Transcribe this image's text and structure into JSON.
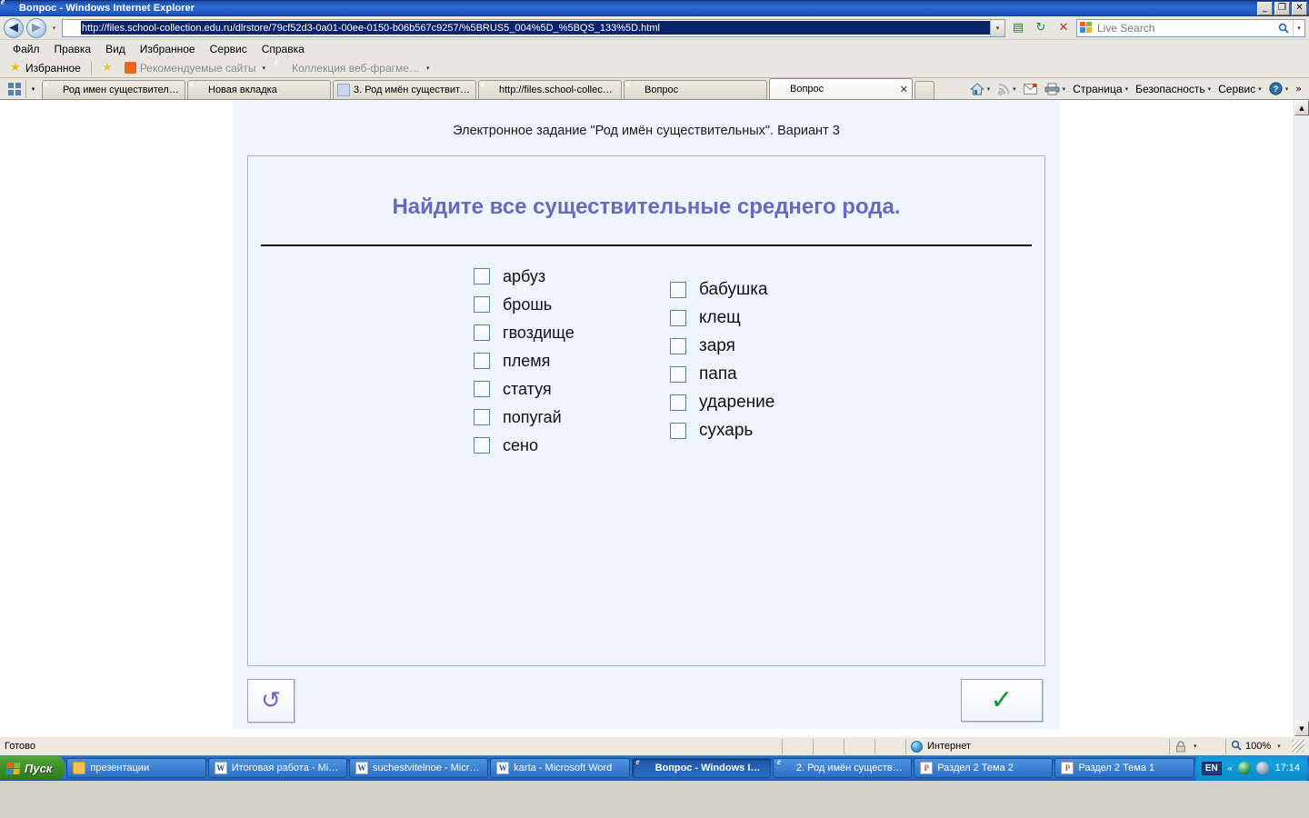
{
  "window": {
    "title": "Вопрос - Windows Internet Explorer",
    "minimize_label": "_",
    "restore_label": "❐",
    "close_label": "✕"
  },
  "nav": {
    "back_label": "◀",
    "forward_label": "▶",
    "recent_caret": "▾",
    "address_value": "http://files.school-collection.edu.ru/dlrstore/79cf52d3-0a01-00ee-0150-b06b567c9257/%5BRUS5_004%5D_%5BQS_133%5D.html",
    "address_caret": "▾",
    "compat_label": "▤",
    "refresh_label": "↻",
    "stop_label": "✕",
    "search_placeholder": "Live Search",
    "search_go": "🔍",
    "search_caret": "▾"
  },
  "menubar": {
    "items": [
      {
        "label": "Файл"
      },
      {
        "label": "Правка"
      },
      {
        "label": "Вид"
      },
      {
        "label": "Избранное"
      },
      {
        "label": "Сервис"
      },
      {
        "label": "Справка"
      }
    ]
  },
  "favbar": {
    "favorites_label": "Избранное",
    "items": [
      {
        "label": "Рекомендуемые сайты",
        "caret": "▾"
      },
      {
        "label": "Коллекция веб-фрагме…",
        "caret": "▾"
      }
    ]
  },
  "tabbar": {
    "quicktabs_caret": "▾",
    "tabs": [
      {
        "label": "Род имен существител…",
        "icon": "ie-icon",
        "active": false,
        "closable": false
      },
      {
        "label": "Новая вкладка",
        "icon": "ie-icon",
        "active": false,
        "closable": false
      },
      {
        "label": "3. Род имён существит…",
        "icon": "page-icon",
        "active": false,
        "closable": false
      },
      {
        "label": "http://files.school-collec…",
        "icon": "ie-icon",
        "active": false,
        "closable": false
      },
      {
        "label": "Вопрос",
        "icon": "ie-icon",
        "active": false,
        "closable": false
      },
      {
        "label": "Вопрос",
        "icon": "ie-icon",
        "active": true,
        "closable": true,
        "close_label": "✕"
      }
    ],
    "commands": [
      {
        "label": "Страница",
        "caret": "▾"
      },
      {
        "label": "Безопасность",
        "caret": "▾"
      },
      {
        "label": "Сервис",
        "caret": "▾"
      }
    ],
    "home_caret": "▾",
    "feeds_caret": "▾",
    "print_caret": "▾",
    "help_caret": "▾",
    "overflow_label": "»"
  },
  "page": {
    "task_title": "Электронное задание \"Род имён существительных\". Вариант 3",
    "question": "Найдите все существительные среднего рода.",
    "accent_color": "#6b68c0",
    "panel_bg": "#eff5fd",
    "options_left": [
      {
        "label": "арбуз",
        "checked": false
      },
      {
        "label": "брошь",
        "checked": false
      },
      {
        "label": "гвоздище",
        "checked": false
      },
      {
        "label": "племя",
        "checked": false
      },
      {
        "label": "статуя",
        "checked": false
      },
      {
        "label": "попугай",
        "checked": false
      },
      {
        "label": "сено",
        "checked": false
      }
    ],
    "options_right": [
      {
        "label": "бабушка",
        "checked": false
      },
      {
        "label": "клещ",
        "checked": false
      },
      {
        "label": "заря",
        "checked": false
      },
      {
        "label": "папа",
        "checked": false
      },
      {
        "label": "ударение",
        "checked": false
      },
      {
        "label": "сухарь",
        "checked": false
      }
    ],
    "reset_glyph": "↺",
    "submit_glyph": "✓",
    "submit_color": "#0a9a2e"
  },
  "scrollbar": {
    "up_label": "▲",
    "down_label": "▼"
  },
  "statusbar": {
    "status": "Готово",
    "zone": "Интернет",
    "zone_icon": "globe-icon",
    "protect_caret": "▾",
    "zoom": "100%",
    "zoom_caret": "▾"
  },
  "taskbar": {
    "start_label": "Пуск",
    "items": [
      {
        "label": "презентации",
        "icon": "folder-icon",
        "active": false
      },
      {
        "label": "Итоговая работа - Mic…",
        "icon": "word-icon",
        "active": false
      },
      {
        "label": "suchestvitelnoe - Micro…",
        "icon": "word-icon",
        "active": false
      },
      {
        "label": "karta - Microsoft Word",
        "icon": "word-icon",
        "active": false
      },
      {
        "label": "Вопрос - Windows I…",
        "icon": "ie-icon",
        "active": true
      },
      {
        "label": "2. Род имён существи…",
        "icon": "ie-icon",
        "active": false
      },
      {
        "label": "Раздел 2 Тема 2",
        "icon": "ppt-icon",
        "active": false
      },
      {
        "label": "Раздел 2 Тема 1",
        "icon": "ppt-icon",
        "active": false
      }
    ],
    "tray": {
      "language": "EN",
      "chevron": "«",
      "clock": "17:14"
    }
  }
}
